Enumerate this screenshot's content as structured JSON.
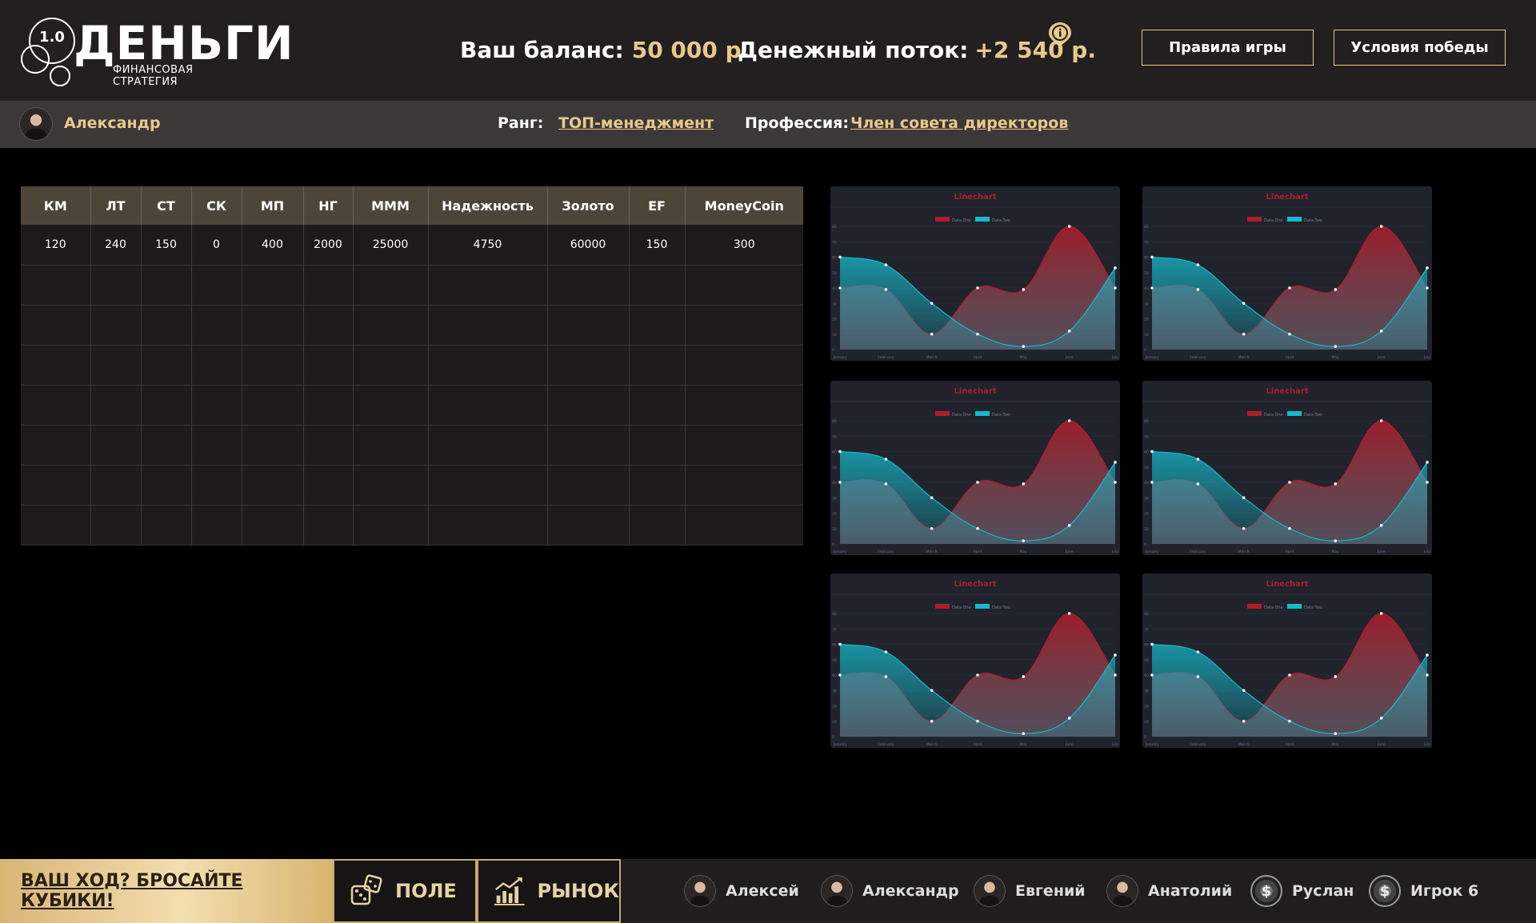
{
  "header": {
    "logo_version": "1.0",
    "logo_title": "ДЕНЬГИ",
    "logo_subtitle": "ФИНАНСОВАЯ СТРАТЕГИЯ",
    "balance_label": "Ваш баланс:",
    "balance_value": "50 000 р.",
    "cashflow_label": "Денежный поток:",
    "cashflow_value": "+2 540 р.",
    "rules_button": "Правила игры",
    "win_button": "Условия победы"
  },
  "profile": {
    "name": "Александр",
    "rank_label": "Ранг:",
    "rank_value": "ТОП-менеджмент",
    "profession_label": "Профессия:",
    "profession_value": "Член совета директоров"
  },
  "assets_table": {
    "headers": [
      "КМ",
      "ЛТ",
      "СТ",
      "СК",
      "МП",
      "НГ",
      "МММ",
      "Надежность",
      "Золото",
      "EF",
      "MoneyCoin"
    ],
    "rows": [
      [
        "120",
        "240",
        "150",
        "0",
        "400",
        "2000",
        "25000",
        "4750",
        "60000",
        "150",
        "300"
      ],
      [
        "",
        "",
        "",
        "",
        "",
        "",
        "",
        "",
        "",
        "",
        ""
      ],
      [
        "",
        "",
        "",
        "",
        "",
        "",
        "",
        "",
        "",
        "",
        ""
      ],
      [
        "",
        "",
        "",
        "",
        "",
        "",
        "",
        "",
        "",
        "",
        ""
      ],
      [
        "",
        "",
        "",
        "",
        "",
        "",
        "",
        "",
        "",
        "",
        ""
      ],
      [
        "",
        "",
        "",
        "",
        "",
        "",
        "",
        "",
        "",
        "",
        ""
      ],
      [
        "",
        "",
        "",
        "",
        "",
        "",
        "",
        "",
        "",
        "",
        ""
      ],
      [
        "",
        "",
        "",
        "",
        "",
        "",
        "",
        "",
        "",
        "",
        ""
      ]
    ]
  },
  "chart_data": {
    "type": "area",
    "title": "Linechart",
    "categories": [
      "January",
      "February",
      "March",
      "April",
      "May",
      "June",
      "July"
    ],
    "ylim": [
      0,
      80
    ],
    "yticks": [
      0,
      10,
      20,
      30,
      40,
      50,
      60,
      70,
      80
    ],
    "series": [
      {
        "name": "Data One",
        "color": "#b01c2a",
        "values": [
          40,
          39,
          10,
          40,
          39,
          80,
          40
        ]
      },
      {
        "name": "Data Two",
        "color": "#17b9cc",
        "values": [
          60,
          55,
          30,
          10,
          2,
          12,
          53
        ]
      }
    ],
    "instances": 6
  },
  "bottom": {
    "turn_text": "ВАШ ХОД? БРОСАЙТЕ КУБИКИ!",
    "field_button": "ПОЛЕ",
    "market_button": "РЫНОК",
    "players": [
      {
        "name": "Алексей",
        "avatar": "photo"
      },
      {
        "name": "Александр",
        "avatar": "photo"
      },
      {
        "name": "Евгений",
        "avatar": "photo"
      },
      {
        "name": "Анатолий",
        "avatar": "photo"
      },
      {
        "name": "Руслан",
        "avatar": "coin-icon"
      },
      {
        "name": "Игрок 6",
        "avatar": "coin-icon"
      }
    ]
  }
}
